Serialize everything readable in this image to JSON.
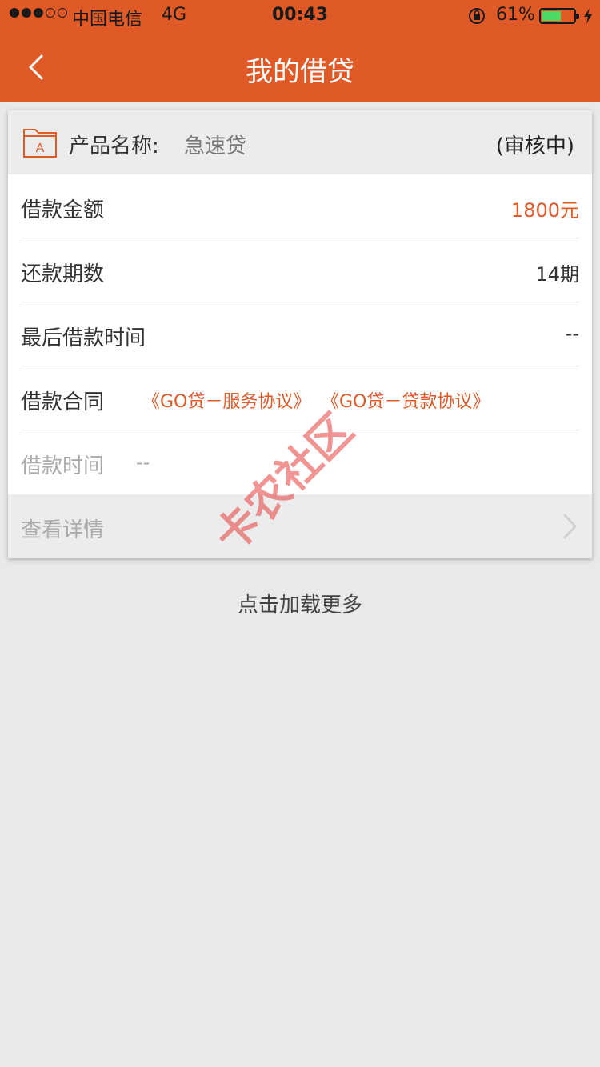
{
  "status_bar": {
    "carrier": "中国电信",
    "network": "4G",
    "time": "00:43",
    "battery_percent": "61%",
    "battery_level": 0.61
  },
  "nav": {
    "title": "我的借贷"
  },
  "loan_card": {
    "product_label": "产品名称:",
    "product_name": "急速贷",
    "status": "(审核中)",
    "rows": [
      {
        "label": "借款金额",
        "value": "1800元"
      },
      {
        "label": "还款期数",
        "value": "14期"
      },
      {
        "label": "最后借款时间",
        "value": "--"
      }
    ],
    "contract": {
      "label": "借款合同",
      "links": [
        "《GO贷－服务协议》",
        "《GO贷－贷款协议》"
      ]
    },
    "loan_time": {
      "label": "借款时间",
      "value": "--"
    },
    "details_label": "查看详情"
  },
  "load_more": "点击加载更多",
  "watermark": "卡农社区",
  "colors": {
    "brand": "#e05a28",
    "background": "#e9e9e9",
    "battery": "#4cd964"
  }
}
